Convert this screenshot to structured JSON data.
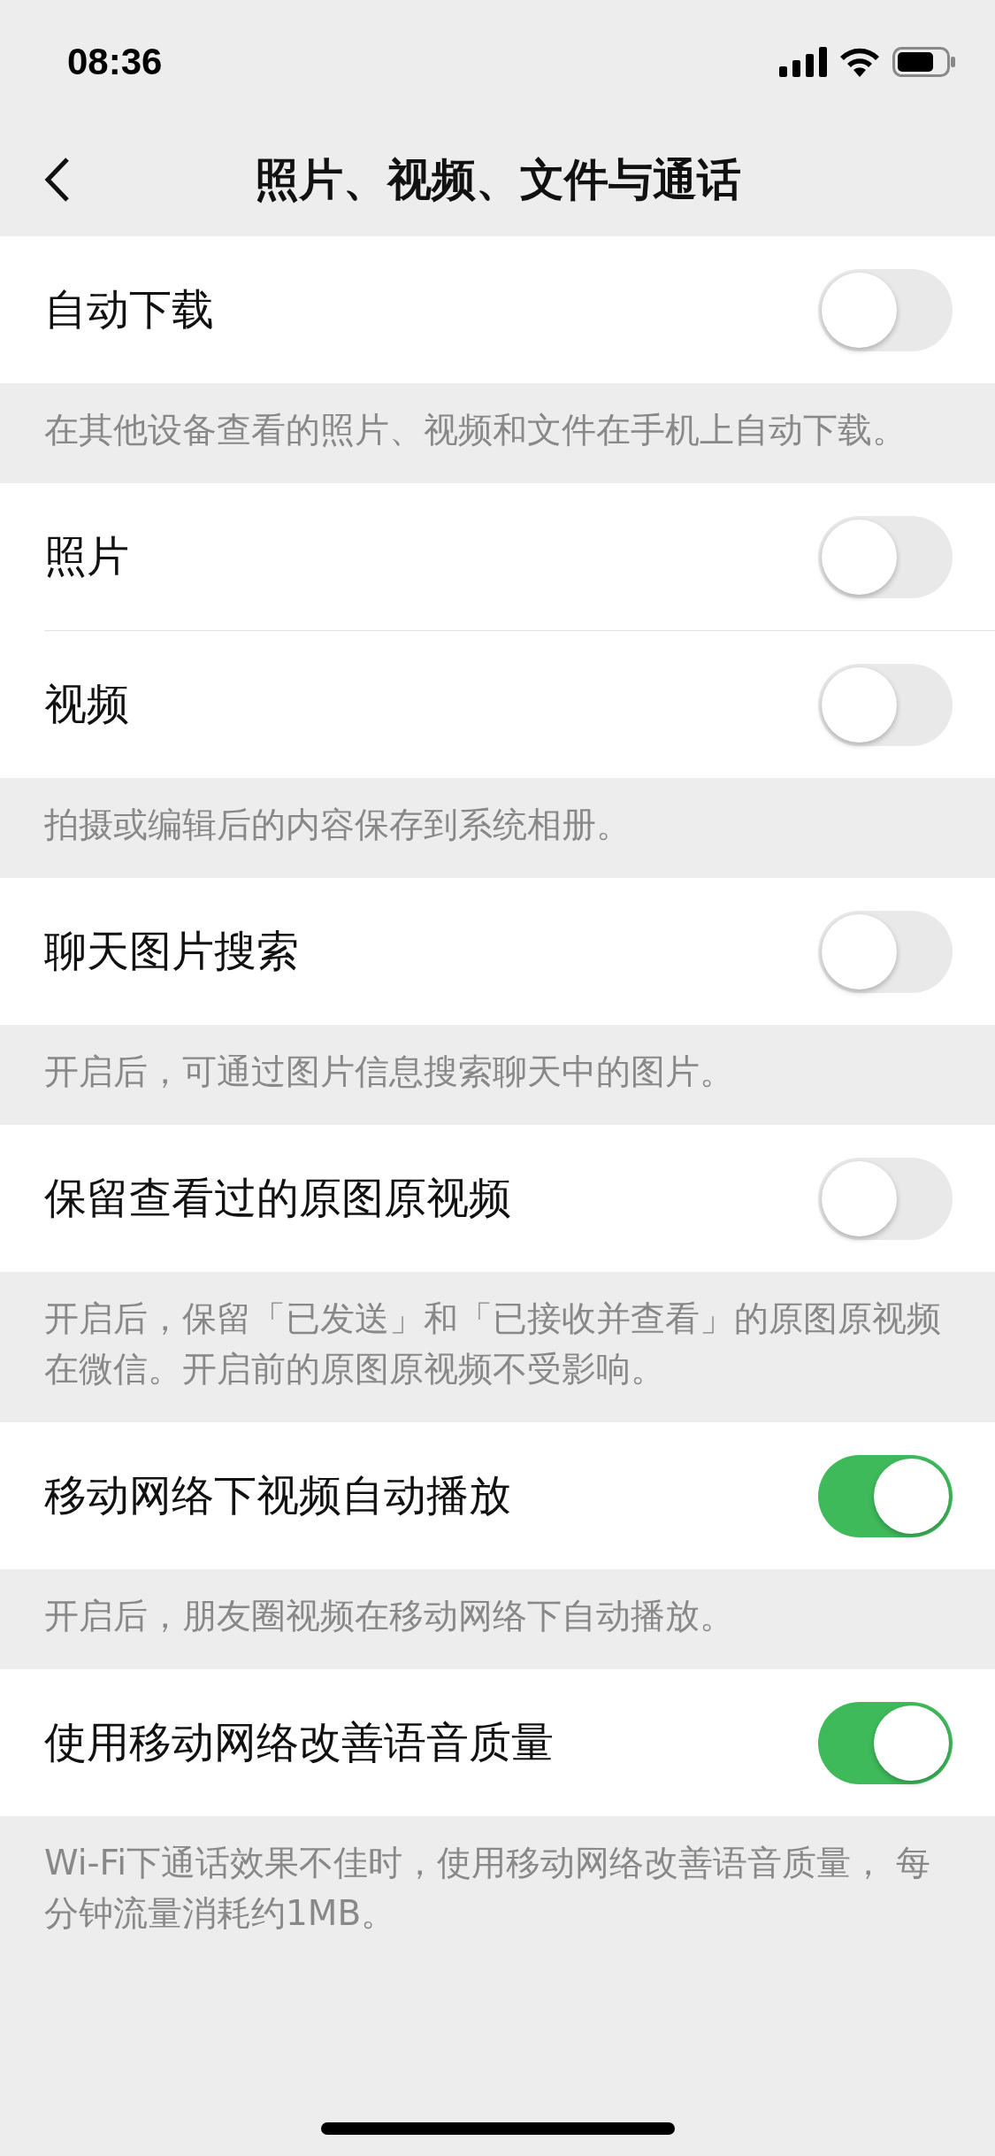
{
  "status_bar": {
    "time": "08:36"
  },
  "nav": {
    "title": "照片、视频、文件与通话"
  },
  "sections": [
    {
      "rows": [
        {
          "label": "自动下载",
          "on": false
        }
      ],
      "note": "在其他设备查看的照片、视频和文件在手机上自动下载。"
    },
    {
      "rows": [
        {
          "label": "照片",
          "on": false
        },
        {
          "label": "视频",
          "on": false
        }
      ],
      "note": "拍摄或编辑后的内容保存到系统相册。"
    },
    {
      "rows": [
        {
          "label": "聊天图片搜索",
          "on": false
        }
      ],
      "note": "开启后，可通过图片信息搜索聊天中的图片。"
    },
    {
      "rows": [
        {
          "label": "保留查看过的原图原视频",
          "on": false
        }
      ],
      "note": "开启后，保留「已发送」和「已接收并查看」的原图原视频在微信。开启前的原图原视频不受影响。"
    },
    {
      "rows": [
        {
          "label": "移动网络下视频自动播放",
          "on": true
        }
      ],
      "note": "开启后，朋友圈视频在移动网络下自动播放。"
    },
    {
      "rows": [
        {
          "label": "使用移动网络改善语音质量",
          "on": true
        }
      ],
      "note": "Wi-Fi下通话效果不佳时，使用移动网络改善语音质量， 每分钟流量消耗约1MB。"
    }
  ]
}
